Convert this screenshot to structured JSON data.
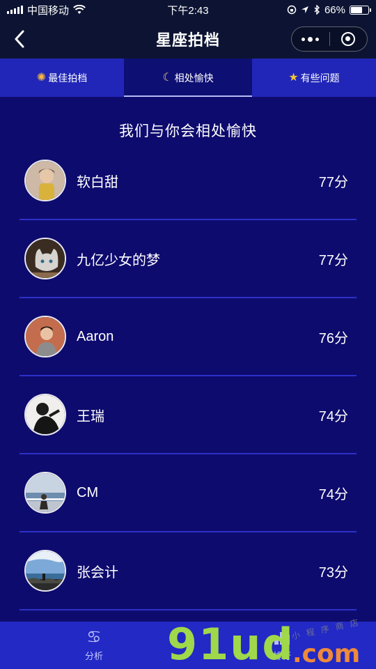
{
  "status_bar": {
    "carrier": "中国移动",
    "time": "下午2:43",
    "battery_percent": "66%",
    "battery_level": 0.66
  },
  "nav": {
    "title": "星座拍档"
  },
  "tabs": [
    {
      "label": "最佳拍档",
      "icon": "sun-icon",
      "selected": false
    },
    {
      "label": "相处愉快",
      "icon": "moon-icon",
      "selected": true
    },
    {
      "label": "有些问题",
      "icon": "star-icon",
      "selected": false
    }
  ],
  "section_title": "我们与你会相处愉快",
  "users": [
    {
      "name": "软白甜",
      "score": "77分"
    },
    {
      "name": "九亿少女的梦",
      "score": "77分"
    },
    {
      "name": "Aaron",
      "score": "76分"
    },
    {
      "name": "王瑞",
      "score": "74分"
    },
    {
      "name": "CM",
      "score": "74分"
    },
    {
      "name": "张会计",
      "score": "73分"
    }
  ],
  "bottom_tabs": [
    {
      "label": "分析",
      "icon": "cancer-zodiac-icon"
    },
    {
      "label": "排行",
      "icon": "ranking-icon"
    }
  ],
  "watermark": {
    "main": "91ud",
    "com": ".com",
    "small": "小 程 序 商 店"
  },
  "colors": {
    "background": "#0e0b6e",
    "tab_bar": "#2126b8",
    "bottom_bar": "#2229c4",
    "divider": "#2c30c8"
  }
}
